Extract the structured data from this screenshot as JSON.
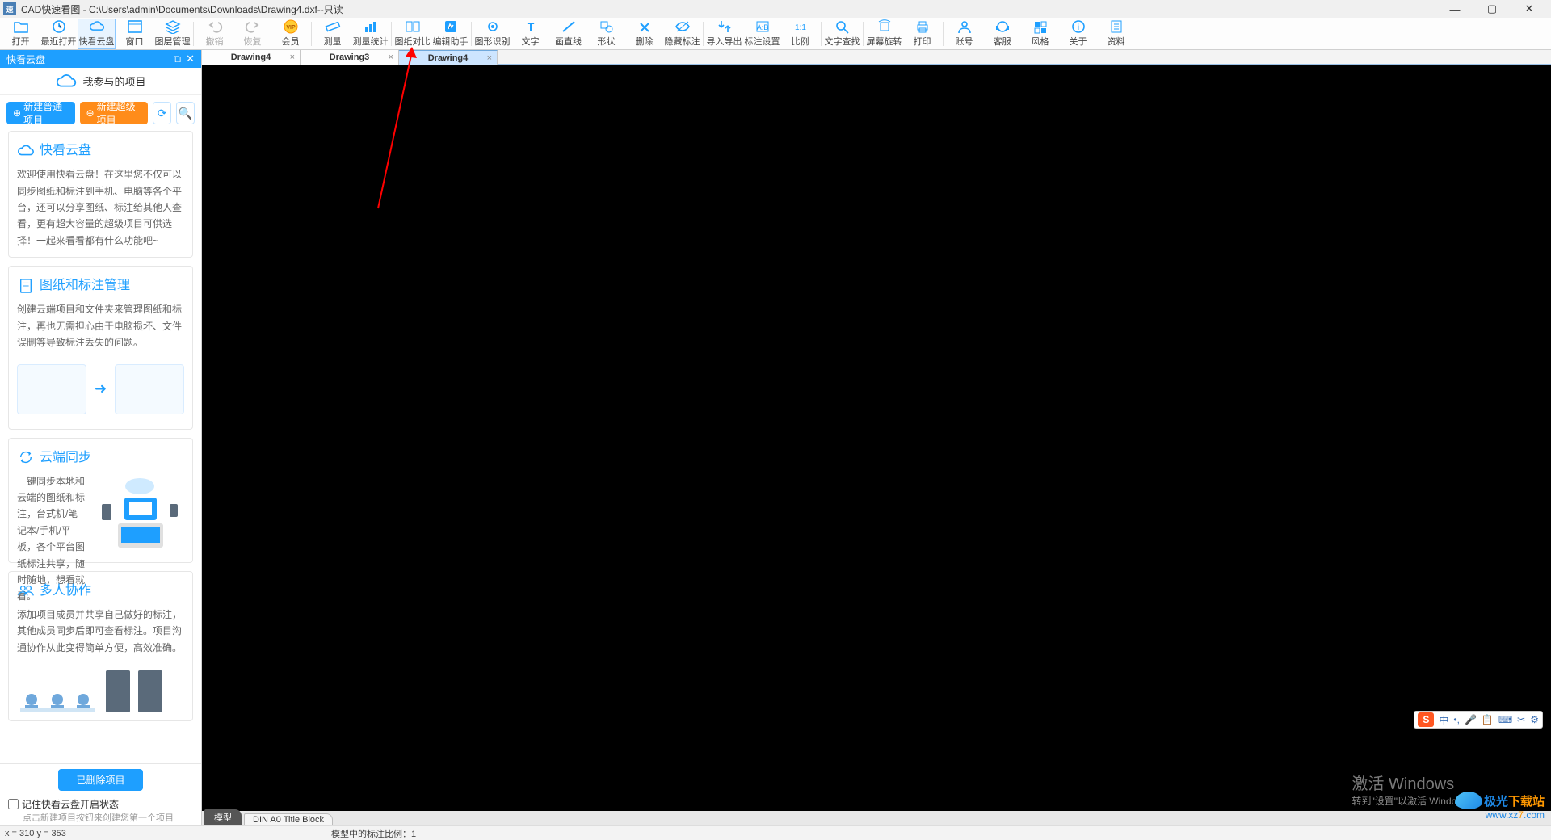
{
  "window": {
    "title": "CAD快速看图 - C:\\Users\\admin\\Documents\\Downloads\\Drawing4.dxf--只读",
    "app_badge": "速"
  },
  "toolbar": [
    {
      "id": "open",
      "label": "打开"
    },
    {
      "id": "recent",
      "label": "最近打开"
    },
    {
      "id": "cloud",
      "label": "快看云盘",
      "selected": true
    },
    {
      "id": "window",
      "label": "窗口"
    },
    {
      "id": "layer",
      "label": "图层管理"
    },
    {
      "id": "sep"
    },
    {
      "id": "undo",
      "label": "撤销",
      "disabled": true
    },
    {
      "id": "redo",
      "label": "恢复",
      "disabled": true
    },
    {
      "id": "vip",
      "label": "会员",
      "orange": true
    },
    {
      "id": "sep"
    },
    {
      "id": "measure",
      "label": "测量"
    },
    {
      "id": "mstats",
      "label": "测量统计"
    },
    {
      "id": "sep"
    },
    {
      "id": "compare",
      "label": "图纸对比"
    },
    {
      "id": "edit-helper",
      "label": "编辑助手"
    },
    {
      "id": "sep"
    },
    {
      "id": "recog",
      "label": "图形识别"
    },
    {
      "id": "text",
      "label": "文字"
    },
    {
      "id": "line",
      "label": "画直线"
    },
    {
      "id": "shape",
      "label": "形状"
    },
    {
      "id": "delete",
      "label": "删除"
    },
    {
      "id": "hide",
      "label": "隐藏标注"
    },
    {
      "id": "sep"
    },
    {
      "id": "impexp",
      "label": "导入导出"
    },
    {
      "id": "markset",
      "label": "标注设置"
    },
    {
      "id": "scale",
      "label": "比例"
    },
    {
      "id": "sep"
    },
    {
      "id": "findtext",
      "label": "文字查找"
    },
    {
      "id": "sep"
    },
    {
      "id": "rotate",
      "label": "屏幕旋转"
    },
    {
      "id": "print",
      "label": "打印"
    },
    {
      "id": "sep"
    },
    {
      "id": "account",
      "label": "账号"
    },
    {
      "id": "support",
      "label": "客服"
    },
    {
      "id": "style",
      "label": "风格"
    },
    {
      "id": "about",
      "label": "关于"
    },
    {
      "id": "docs",
      "label": "资料"
    }
  ],
  "sidepanel": {
    "title": "快看云盘",
    "my_projects": "我参与的项目",
    "btn_new_normal": "新建普通项目",
    "btn_new_super": "新建超级项目",
    "cards": {
      "intro": {
        "title": "快看云盘",
        "body": "欢迎使用快看云盘！在这里您不仅可以同步图纸和标注到手机、电脑等各个平台，还可以分享图纸、标注给其他人查看，更有超大容量的超级项目可供选择！一起来看看都有什么功能吧~"
      },
      "manage": {
        "title": "图纸和标注管理",
        "body": "创建云端项目和文件夹来管理图纸和标注，再也无需担心由于电脑损坏、文件误删等导致标注丢失的问题。"
      },
      "sync": {
        "title": "云端同步",
        "body": "一键同步本地和云端的图纸和标注，台式机/笔记本/手机/平板，各个平台图纸标注共享，随时随地，想看就看。"
      },
      "collab": {
        "title": "多人协作",
        "body": "添加项目成员并共享自己做好的标注，其他成员同步后即可查看标注。项目沟通协作从此变得简单方便，高效准确。"
      }
    },
    "deleted_btn": "已删除项目",
    "remember_chk": "记住快看云盘开启状态",
    "hint": "点击新建项目按钮来创建您第一个项目"
  },
  "tabs": [
    {
      "label": "Drawing4",
      "active": false
    },
    {
      "label": "Drawing3",
      "active": false
    },
    {
      "label": "Drawing4",
      "active": true
    }
  ],
  "bottom_tabs": {
    "model": "模型",
    "layout": "DIN A0 Title Block"
  },
  "statusbar": {
    "coords": "x = 310  y = 353",
    "scale": "模型中的标注比例：1"
  },
  "activate": {
    "line1": "激活 Windows",
    "line2": "转到\"设置\"以激活 Windows。"
  },
  "watermark": {
    "brand_blue": "极光",
    "brand_orange": "下载站",
    "url_pre": "www.xz",
    "url_mid": "7",
    "url_post": ".com"
  },
  "ime": {
    "lang": "中",
    "items": [
      "•,",
      "🎤",
      "📋",
      "⌨",
      "✂",
      "⚙"
    ]
  }
}
